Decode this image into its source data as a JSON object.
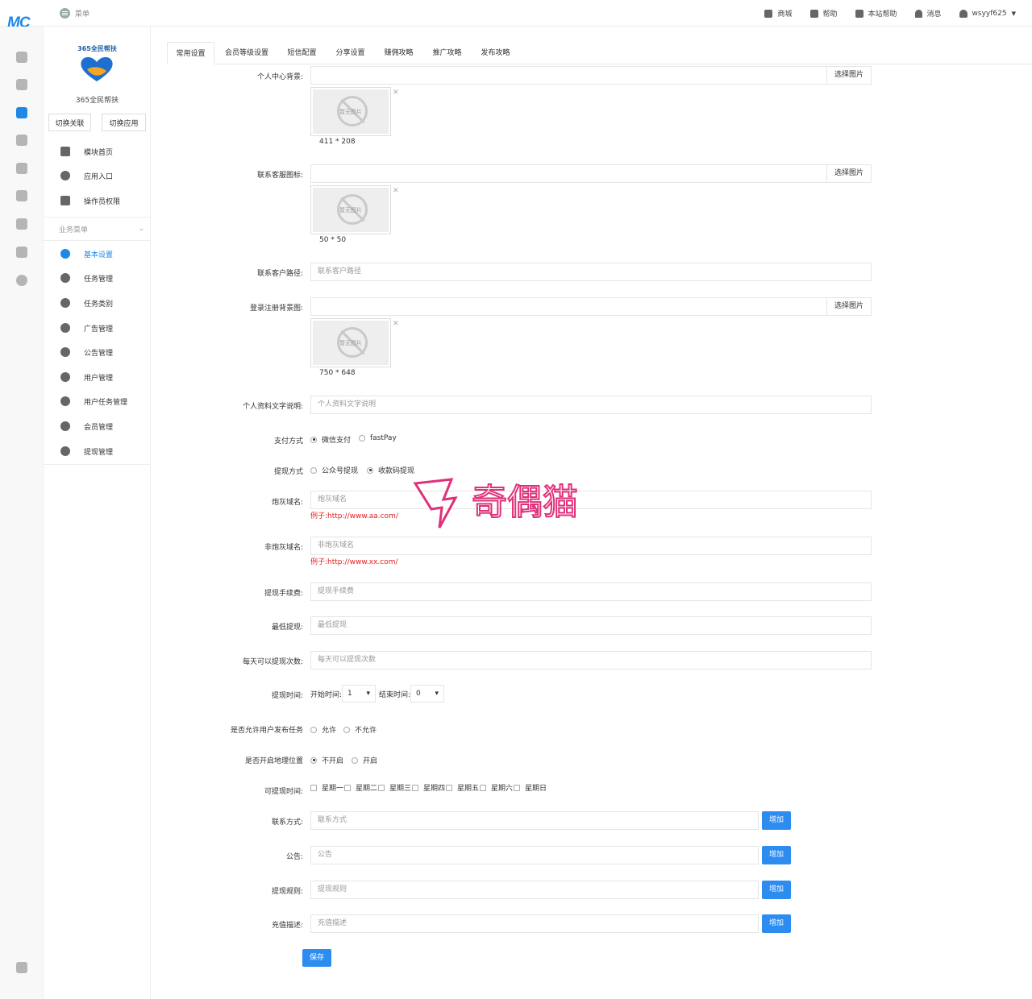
{
  "topbar": {
    "logo": "MC",
    "menu_label": "菜单",
    "nav": [
      {
        "label": "商城",
        "icon": "store-icon"
      },
      {
        "label": "帮助",
        "icon": "help-icon"
      },
      {
        "label": "本站帮助",
        "icon": "site-help-icon"
      },
      {
        "label": "消息",
        "icon": "bell-icon"
      },
      {
        "label": "wsyyf625",
        "icon": "user-icon"
      }
    ]
  },
  "rail": [
    "home-icon",
    "apps-icon",
    "module-icon",
    "plugins-icon",
    "store-settings-icon",
    "users-icon",
    "account-icon",
    "monitor-icon",
    "globe-icon",
    "lock-icon"
  ],
  "sidebar": {
    "brand_top": "365全民帮扶",
    "brand_name": "365全民帮扶",
    "switch_link": "切换关联",
    "switch_app": "切换应用",
    "items": [
      {
        "label": "模块首页"
      },
      {
        "label": "应用入口"
      },
      {
        "label": "操作员权限"
      }
    ],
    "section": "业务菜单",
    "business": [
      {
        "label": "基本设置"
      },
      {
        "label": "任务管理"
      },
      {
        "label": "任务类别"
      },
      {
        "label": "广告管理"
      },
      {
        "label": "公告管理"
      },
      {
        "label": "用户管理"
      },
      {
        "label": "用户任务管理"
      },
      {
        "label": "会员管理"
      },
      {
        "label": "提现管理"
      }
    ]
  },
  "tabs": [
    "常用设置",
    "会员等级设置",
    "短信配置",
    "分享设置",
    "赚佣攻略",
    "推广攻略",
    "发布攻略"
  ],
  "form": {
    "bg_label": "个人中心背景:",
    "pick": "选择图片",
    "noimg": "暂无图片",
    "bg_size": "411 * 208",
    "service_icon_label": "联系客服图标:",
    "service_icon_size": "50 * 50",
    "service_path_label": "联系客户路径:",
    "service_path_ph": "联系客户路径",
    "login_bg_label": "登录注册背景图:",
    "login_bg_size": "750 * 648",
    "profile_text_label": "个人资料文字说明:",
    "profile_text_ph": "个人资料文字说明",
    "pay_label": "支付方式",
    "pay_options": [
      "微信支付",
      "fastPay"
    ],
    "withdraw_label": "提现方式",
    "withdraw_options": [
      "公众号提现",
      "收款码提现"
    ],
    "ash_domain_label": "炮灰域名:",
    "ash_domain_ph": "炮灰域名",
    "ash_domain_hint": "例子:http://www.aa.com/",
    "non_ash_label": "非炮灰域名:",
    "non_ash_ph": "非炮灰域名",
    "non_ash_hint": "例子:http://www.xx.com/",
    "fee_label": "提现手续费:",
    "fee_ph": "提现手续费",
    "min_label": "最低提现:",
    "min_ph": "最低提现",
    "times_label": "每天可以提现次数:",
    "times_ph": "每天可以提现次数",
    "time_label": "提现时间:",
    "start_label": "开始时间:",
    "start_value": "1",
    "end_label": "结束时间:",
    "end_value": "0",
    "allow_label": "是否允许用户发布任务",
    "allow_options": [
      "允许",
      "不允许"
    ],
    "geo_label": "是否开启地理位置",
    "geo_options": [
      "不开启",
      "开启"
    ],
    "days_label": "可提现时间:",
    "days": [
      "星期一",
      "星期二",
      "星期三",
      "星期四",
      "星期五",
      "星期六",
      "星期日"
    ],
    "contact_label": "联系方式:",
    "contact_ph": "联系方式",
    "notice_label": "公告:",
    "notice_ph": "公告",
    "rule_label": "提现规则:",
    "rule_ph": "提现规则",
    "recharge_label": "充值描述:",
    "recharge_ph": "充值描述",
    "add": "增加",
    "save": "保存"
  },
  "watermark": "奇偶猫",
  "colors": {
    "accent": "#2d8cf0",
    "hint": "#e02020",
    "brand_blue": "#1e88e5"
  }
}
